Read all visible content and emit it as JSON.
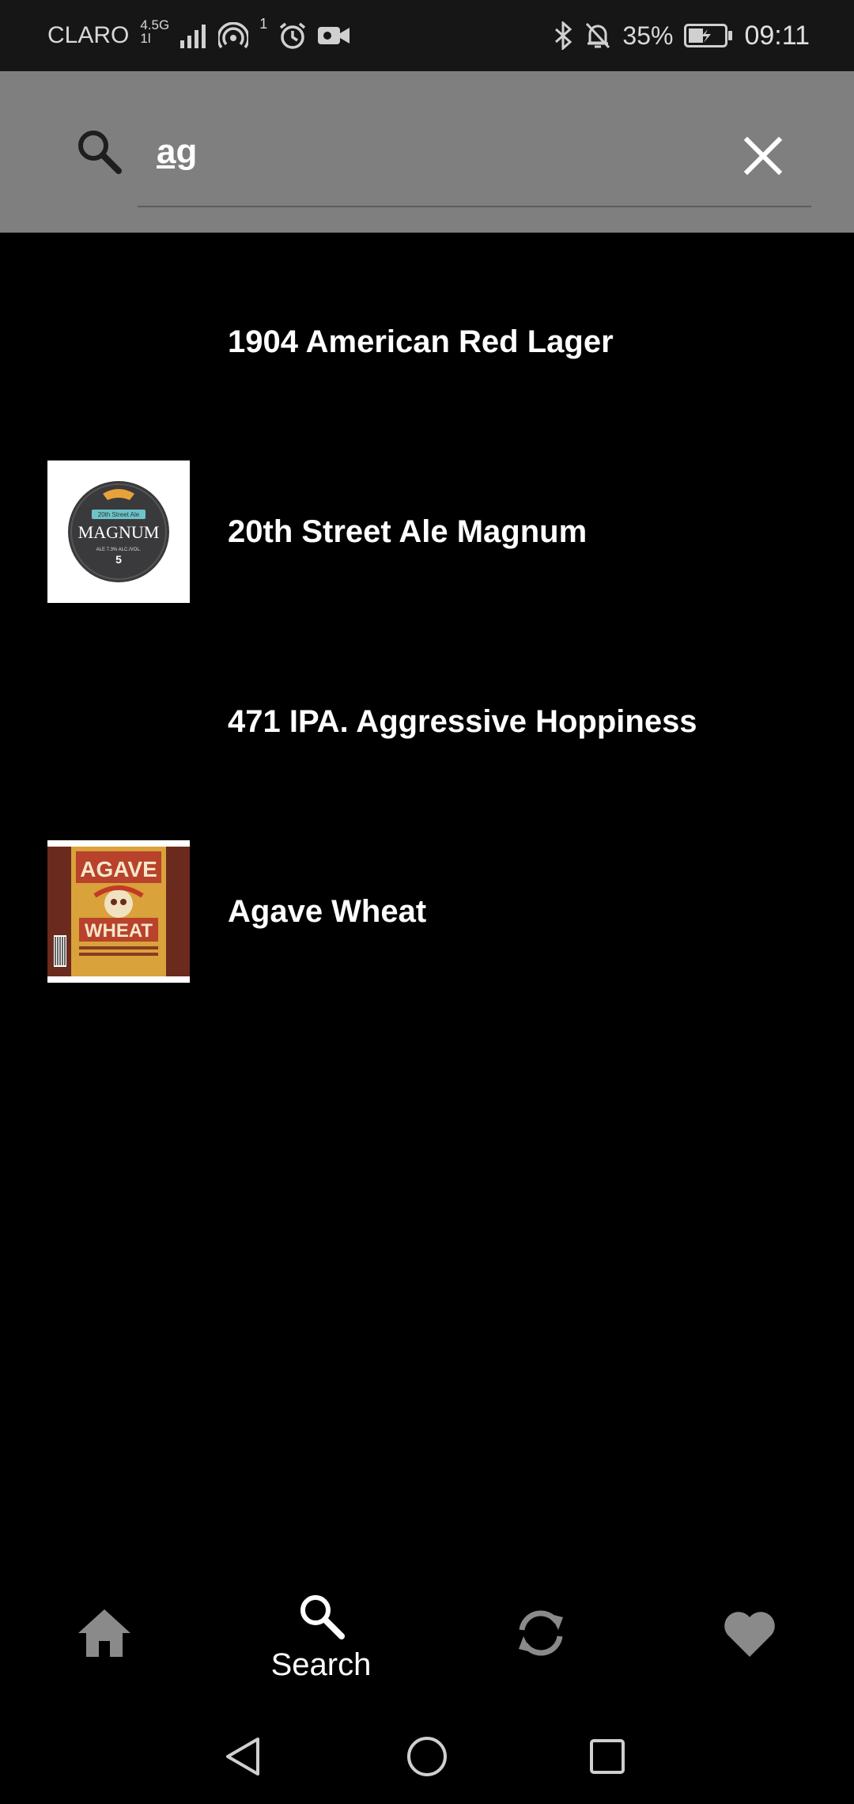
{
  "status_bar": {
    "carrier": "CLARO",
    "network_top": "4.5G",
    "network_bottom": "1l",
    "hotspot_count": "1",
    "battery_percent": "35%",
    "clock": "09:11"
  },
  "search": {
    "query": "ag",
    "placeholder": ""
  },
  "results": [
    {
      "name": "1904 American Red Lager",
      "has_image": false
    },
    {
      "name": "20th Street Ale Magnum",
      "has_image": true,
      "image": "magnum-label"
    },
    {
      "name": "471 IPA. Aggressive Hoppiness",
      "has_image": false
    },
    {
      "name": "Agave Wheat",
      "has_image": true,
      "image": "agave-wheat-label"
    }
  ],
  "magnum_label": {
    "line1": "20th Street Ale",
    "line2": "MAGNUM",
    "line3": "ALE 7.3% ALC./VOL.",
    "line4": "5"
  },
  "agave_label": {
    "line1": "AGAVE",
    "line2": "WHEAT"
  },
  "bottom_nav": {
    "items": [
      {
        "icon": "home-icon",
        "label": ""
      },
      {
        "icon": "search-icon",
        "label": "Search",
        "active": true
      },
      {
        "icon": "refresh-icon",
        "label": ""
      },
      {
        "icon": "heart-icon",
        "label": ""
      }
    ]
  },
  "colors": {
    "status_bar_bg": "#161616",
    "header_bg": "#7f7f7f",
    "page_bg": "#000000",
    "inactive_icon": "#8a8a8a",
    "active_icon": "#ffffff"
  }
}
